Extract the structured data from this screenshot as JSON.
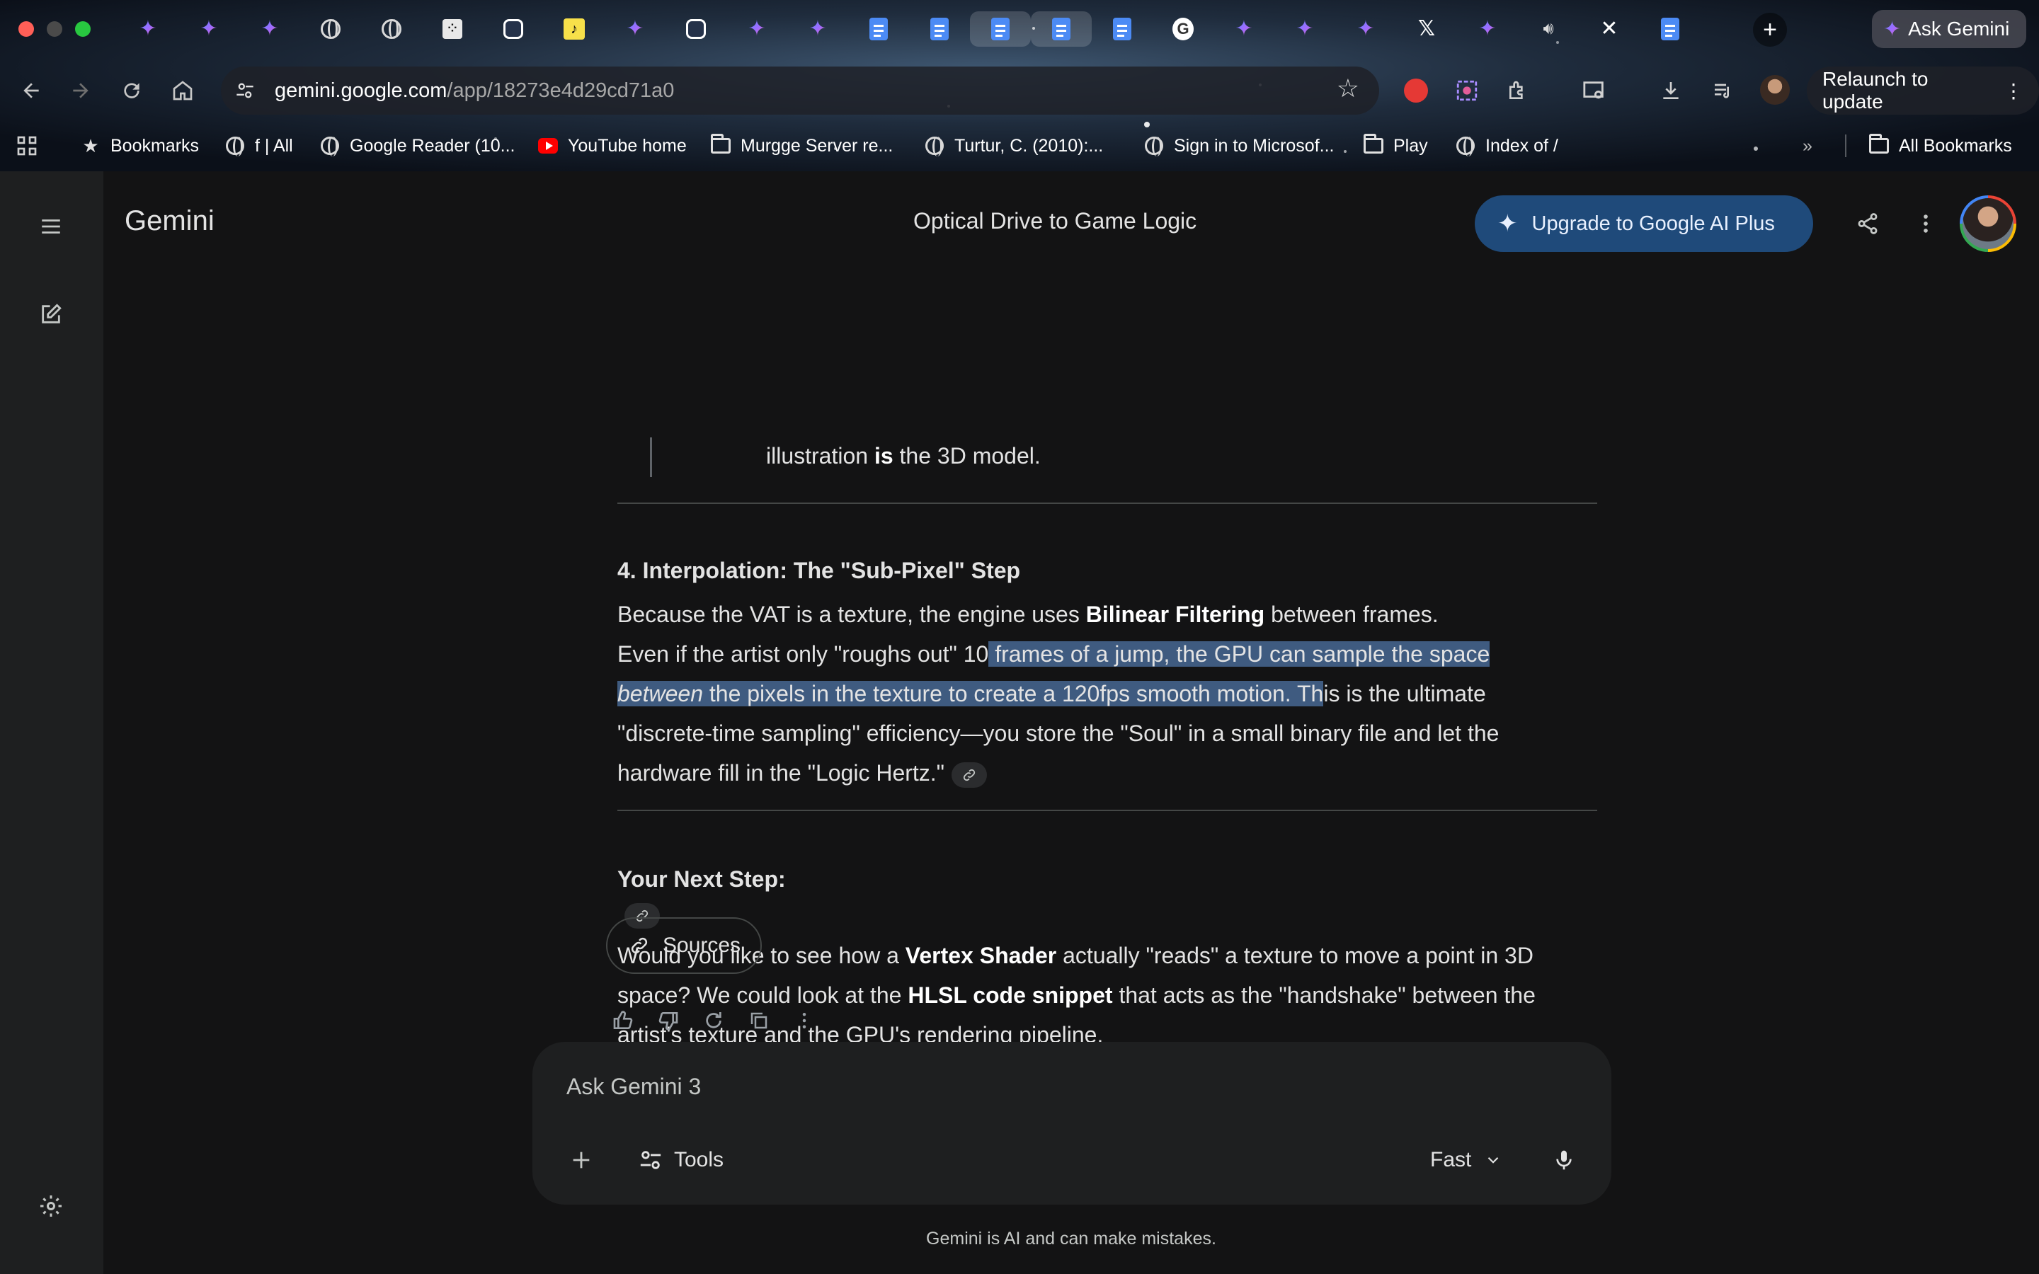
{
  "browser": {
    "ask_gemini_label": "Ask Gemini",
    "url_domain": "gemini.google.com",
    "url_path": "/app/18273e4d29cd71a0",
    "relaunch_label": "Relaunch to update",
    "bookmarks": [
      {
        "label": "Bookmarks",
        "icon": "star-icon"
      },
      {
        "label": "f | All",
        "icon": "globe-icon"
      },
      {
        "label": "Google Reader (10...",
        "icon": "globe-icon"
      },
      {
        "label": "YouTube home",
        "icon": "youtube-icon"
      },
      {
        "label": "Murgge Server re...",
        "icon": "folder-icon"
      },
      {
        "label": "Turtur, C. (2010):...",
        "icon": "globe-icon"
      },
      {
        "label": "Sign in to Microsof...",
        "icon": "globe-icon"
      },
      {
        "label": "Play",
        "icon": "folder-icon"
      },
      {
        "label": "Index of /",
        "icon": "globe-icon"
      }
    ],
    "all_bookmarks_label": "All Bookmarks"
  },
  "app": {
    "brand": "Gemini",
    "conversation_title": "Optical Drive to Game Logic",
    "upgrade_label": "Upgrade to Google AI Plus"
  },
  "message": {
    "quote_start": "illustration ",
    "quote_bold": "is",
    "quote_end": " the 3D model.",
    "section4_heading": "4. Interpolation: The \"Sub-Pixel\" Step",
    "p4_l1_a": "Because the VAT is a texture, the engine uses ",
    "p4_l1_b": "Bilinear Filtering",
    "p4_l1_c": " between frames.",
    "p4_l2_a": "Even if the artist only \"roughs out\" 10",
    "p4_l2_sel": " frames of a jump, the GPU can sample the space ",
    "p4_l3_sel_em": "between",
    "p4_l3_sel": " the pixels in the texture to create a 120fps smooth motion. Th",
    "p4_l3_b": "is is the ultimate",
    "p4_l4": "\"discrete-time sampling\" efficiency—you store the \"Soul\" in a small binary file and let the",
    "p4_l5": "hardware fill in the \"Logic Hertz.\"",
    "next_heading": "Your Next Step:",
    "p5_l1_a": "Would you like to see how a ",
    "p5_l1_b": "Vertex Shader",
    "p5_l1_c": " actually \"reads\" a texture to move a point in 3D",
    "p5_l2_a": "space? We could look at the ",
    "p5_l2_b": "HLSL code snippet",
    "p5_l2_c": " that acts as the \"handshake\" between the",
    "p5_l3": "artist's texture and the GPU's rendering pipeline.",
    "sources_label": "Sources"
  },
  "composer": {
    "placeholder": "Ask Gemini 3",
    "tools_label": "Tools",
    "mode_label": "Fast"
  },
  "footer": {
    "disclaimer": "Gemini is AI and can make mistakes."
  },
  "colors": {
    "background": "#131314",
    "sidebar": "#1e1f20",
    "upgrade_button": "#1f4a7a",
    "selection": "#3f5b80"
  }
}
